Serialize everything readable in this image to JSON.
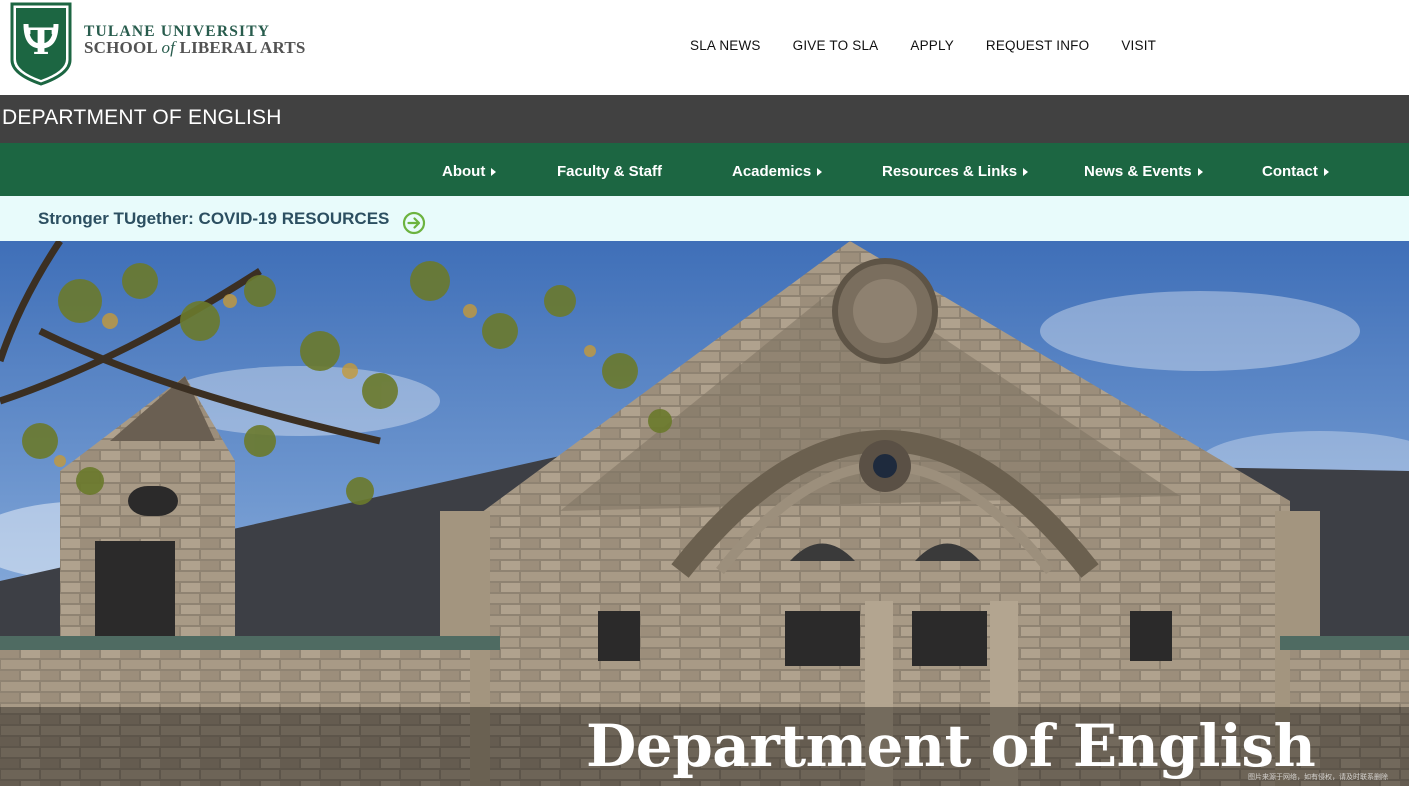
{
  "header": {
    "brand_line1": "TULANE UNIVERSITY",
    "brand_line2_a": "SCHOOL ",
    "brand_line2_of": "of",
    "brand_line2_b": " LIBERAL ARTS",
    "logo_icon": "tulane-shield-icon",
    "utility_nav": [
      "SLA NEWS",
      "GIVE TO SLA",
      "APPLY",
      "REQUEST INFO",
      "VISIT"
    ]
  },
  "department": {
    "title": "DEPARTMENT OF ENGLISH"
  },
  "main_nav": {
    "items": [
      {
        "label": "About",
        "has_submenu": true
      },
      {
        "label": "Faculty & Staff",
        "has_submenu": false
      },
      {
        "label": "Academics",
        "has_submenu": true
      },
      {
        "label": "Resources & Links",
        "has_submenu": true
      },
      {
        "label": "News & Events",
        "has_submenu": true
      },
      {
        "label": "Contact",
        "has_submenu": true
      }
    ]
  },
  "alert": {
    "text": "Stronger TUgether: COVID-19 RESOURCES",
    "icon": "arrow-circle-right-icon"
  },
  "hero": {
    "title": "Department of English",
    "watermark": "图片来源于网络，如有侵权，请及时联系删除"
  },
  "colors": {
    "green_primary": "#1c6642",
    "green_brand": "#285c4d",
    "dark_bar": "#414141",
    "alert_bg": "#e8fbfb",
    "alert_text": "#2c4f61",
    "alert_icon": "#6cb33f"
  }
}
